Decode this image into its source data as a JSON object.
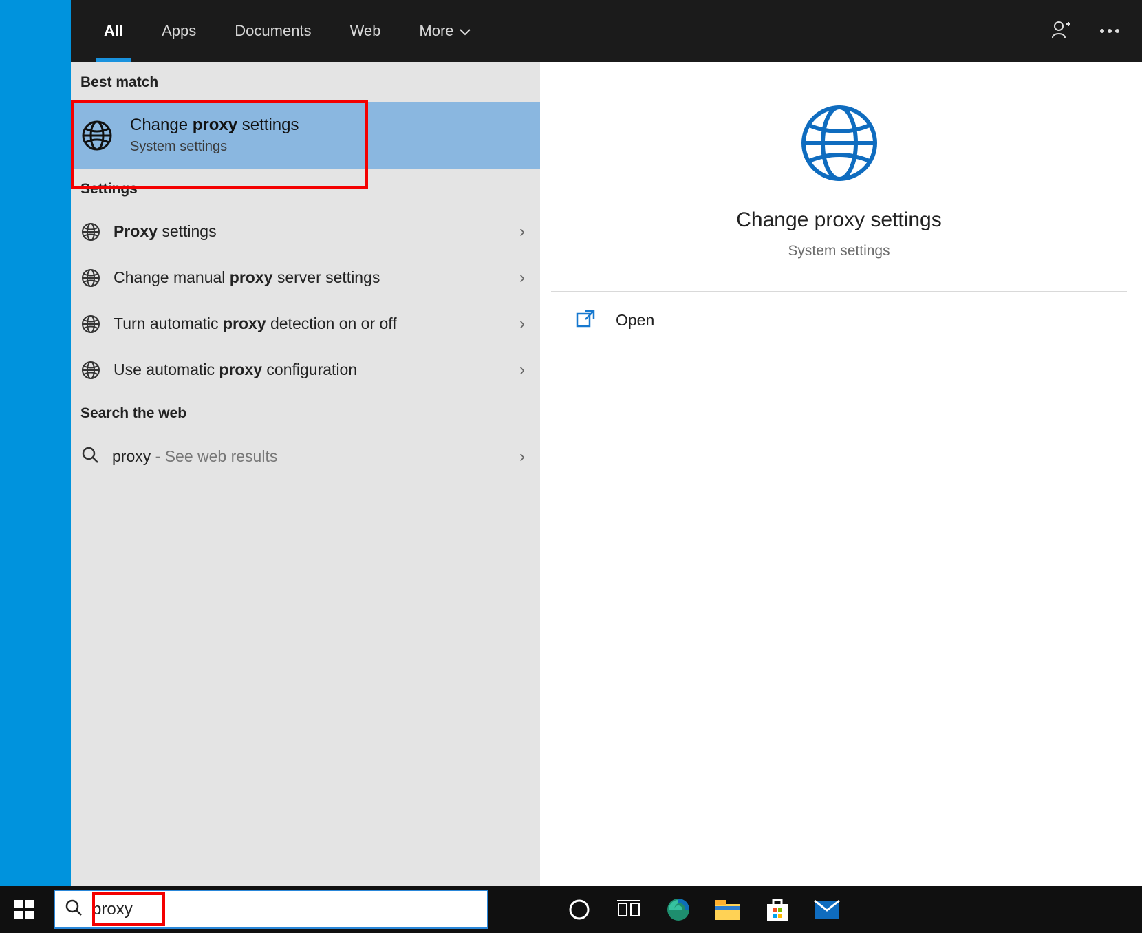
{
  "topbar": {
    "tabs": [
      "All",
      "Apps",
      "Documents",
      "Web",
      "More"
    ]
  },
  "left": {
    "best_match_header": "Best match",
    "best_match": {
      "pre": "Change ",
      "bold": "proxy",
      "post": " settings",
      "sub": "System settings"
    },
    "settings_header": "Settings",
    "settings_items": [
      {
        "pre": "",
        "bold": "Proxy",
        "post": " settings"
      },
      {
        "pre": "Change manual ",
        "bold": "proxy",
        "post": " server settings"
      },
      {
        "pre": "Turn automatic ",
        "bold": "proxy",
        "post": " detection on or off"
      },
      {
        "pre": "Use automatic ",
        "bold": "proxy",
        "post": " configuration"
      }
    ],
    "web_header": "Search the web",
    "web_item": {
      "label": "proxy",
      "hint": " - See web results"
    }
  },
  "detail": {
    "title": "Change proxy settings",
    "sub": "System settings",
    "actions": {
      "open": "Open"
    }
  },
  "search": {
    "value": "proxy"
  }
}
